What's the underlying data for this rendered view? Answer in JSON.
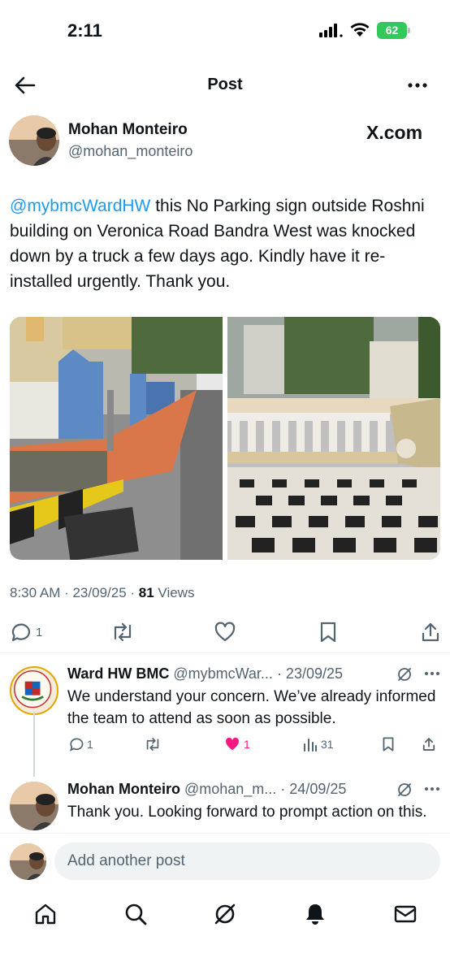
{
  "status_bar": {
    "time": "2:11",
    "battery": "62"
  },
  "header": {
    "title": "Post"
  },
  "post": {
    "author_name": "Mohan Monteiro",
    "author_handle": "@mohan_monteiro",
    "source": "X.com",
    "mention": "@mybmcWardHW",
    "text": " this No Parking sign outside Roshni building on Veronica Road Bandra West was knocked down by a truck a few days ago. Kindly have it re-installed urgently. Thank you.",
    "timestamp": "8:30 AM · 23/09/25 · ",
    "views_count": "81",
    "views_label": " Views",
    "reply_count": "1"
  },
  "replies": [
    {
      "name": "Ward HW BMC",
      "meta": " @mybmcWar... · 23/09/25",
      "text": "We understand your concern. We’ve already informed the team to attend as soon as possible.",
      "replies": "1",
      "likes": "1",
      "views": "31",
      "liked": true
    },
    {
      "name": "Mohan Monteiro",
      "meta": " @mohan_m... · 24/09/25",
      "text": "Thank you. Looking forward to prompt action on this."
    }
  ],
  "compose": {
    "placeholder": "Add another post"
  },
  "colors": {
    "accent": "#1d9bf0",
    "like": "#f91880",
    "battery": "#34c759"
  },
  "tabs": [
    "home-icon",
    "search-icon",
    "grok-icon",
    "notifications-icon",
    "messages-icon"
  ]
}
